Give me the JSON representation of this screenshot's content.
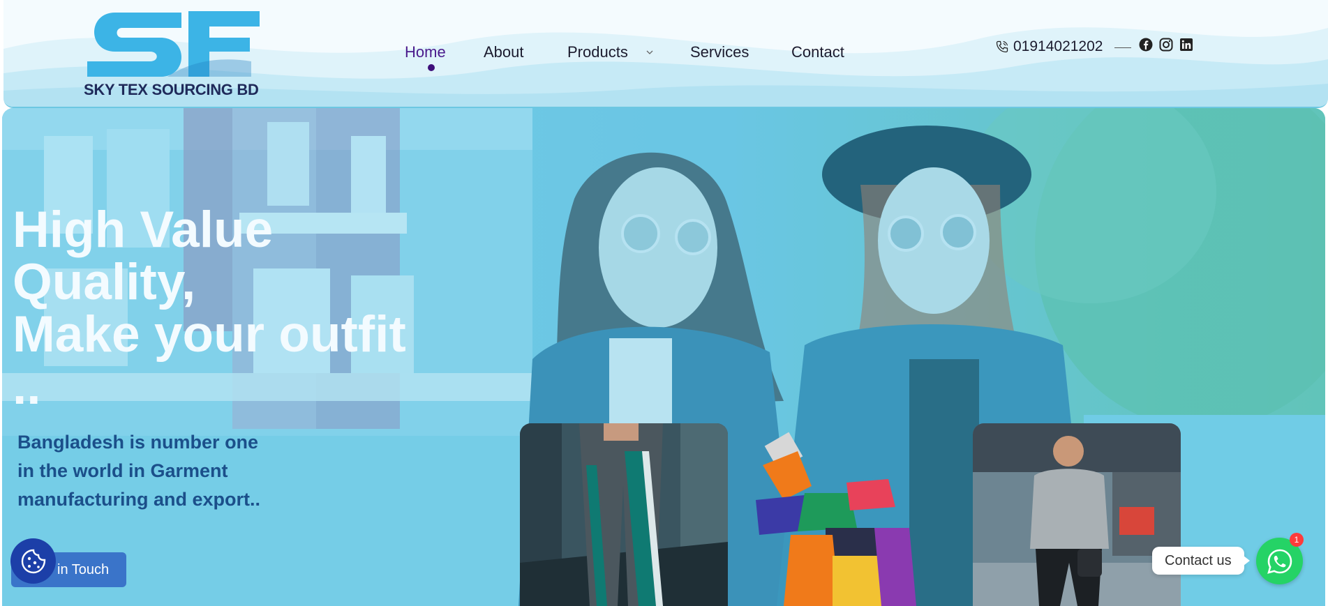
{
  "brand": {
    "name": "SKY TEX SOURCING BD",
    "logo_colors": {
      "primary": "#29a8e0",
      "text": "#1f2a5a"
    }
  },
  "nav": {
    "items": [
      {
        "label": "Home",
        "active": true
      },
      {
        "label": "About",
        "active": false
      },
      {
        "label": "Products",
        "active": false,
        "has_dropdown": true
      },
      {
        "label": "Services",
        "active": false
      },
      {
        "label": "Contact",
        "active": false
      }
    ],
    "active_color": "#4a1a8c"
  },
  "contact": {
    "phone": "01914021202",
    "phone_icon": "phone-icon",
    "social": [
      {
        "icon": "facebook-icon"
      },
      {
        "icon": "instagram-icon"
      },
      {
        "icon": "linkedin-icon"
      }
    ]
  },
  "hero": {
    "headline_lines": [
      "High Value",
      "Quality,",
      "Make your outfit",
      ".."
    ],
    "subline_lines": [
      "Bangladesh is number one",
      "in the world in Garment",
      "manufacturing and export.."
    ],
    "cta_label": "in Touch",
    "overlay_color": "#62c7e6"
  },
  "widgets": {
    "cookie_icon": "cookie-icon",
    "contact_label": "Contact us",
    "whatsapp_badge": "1",
    "whatsapp_icon": "whatsapp-icon",
    "whatsapp_color": "#25d366"
  }
}
